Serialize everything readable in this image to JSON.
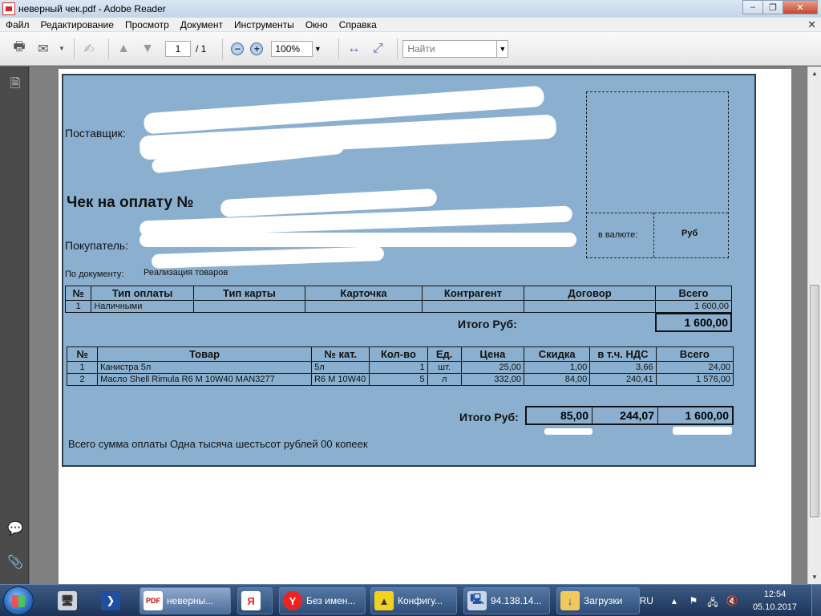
{
  "window": {
    "title": "неверный чек.pdf - Adobe Reader"
  },
  "menu": [
    "Файл",
    "Редактирование",
    "Просмотр",
    "Документ",
    "Инструменты",
    "Окно",
    "Справка"
  ],
  "toolbar": {
    "page_current": "1",
    "page_total": "/ 1",
    "zoom": "100%",
    "find_placeholder": "Найти"
  },
  "document": {
    "supplier_label": "Поставщик:",
    "receipt_title": "Чек на оплату №",
    "buyer_label": "Покупатель:",
    "by_document_label": "По документу:",
    "by_document_value": "Реализация товаров",
    "currency_label": "в валюте:",
    "currency_value": "Руб",
    "payment_table": {
      "headers": [
        "№",
        "Тип оплаты",
        "Тип карты",
        "Карточка",
        "Контрагент",
        "Договор",
        "Всего"
      ],
      "rows": [
        [
          "1",
          "Наличными",
          "",
          "",
          "",
          "",
          "1 600,00"
        ]
      ],
      "total_label": "Итого Руб:",
      "total_value": "1 600,00"
    },
    "goods_table": {
      "headers": [
        "№",
        "Товар",
        "№ кат.",
        "Кол-во",
        "Ед.",
        "Цена",
        "Скидка",
        "в т.ч. НДС",
        "Всего"
      ],
      "rows": [
        [
          "1",
          "Канистра 5л",
          "5л",
          "1",
          "шт.",
          "25,00",
          "1,00",
          "3,66",
          "24,00"
        ],
        [
          "2",
          "Масло Shell Rimula R6 M 10W40 MAN3277",
          "R6 M 10W40",
          "5",
          "л",
          "332,00",
          "84,00",
          "240,41",
          "1 576,00"
        ]
      ],
      "total_label": "Итого Руб:",
      "total_discount": "85,00",
      "total_vat": "244,07",
      "total_sum": "1 600,00"
    },
    "amount_words": "Всего сумма оплаты Одна тысяча шестьсот рублей 00 копеек"
  },
  "taskbar": {
    "tasks": [
      "неверны...",
      "Я",
      "Без имен...",
      "Конфигу...",
      "94.138.14...",
      "Загрузки"
    ],
    "lang": "RU",
    "time": "12:54",
    "date": "05.10.2017"
  }
}
